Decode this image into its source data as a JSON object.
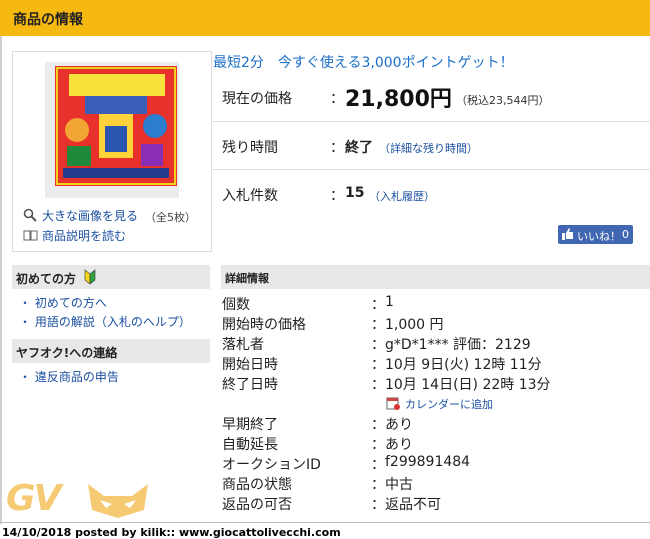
{
  "header": {
    "title": "商品の情報"
  },
  "image": {
    "enlarge_label": "大きな画像を見る",
    "count_label": "（全5枚）",
    "read_desc_label": "商品説明を読む"
  },
  "promo": {
    "text": "最短2分　今すぐ使える3,000ポイントゲット！"
  },
  "price": {
    "label": "現在の価格",
    "value": "21,800円",
    "tax": "（税込23,544円）"
  },
  "remaining": {
    "label": "残り時間",
    "value": "終了",
    "link": "（詳細な残り時間）"
  },
  "bids": {
    "label": "入札件数",
    "value": "15",
    "link": "（入札履歴）"
  },
  "like": {
    "label": "いいね！",
    "count": "0"
  },
  "sidebar": {
    "beginner_title": "初めての方",
    "beginner_items": [
      "初めての方へ",
      "用語の解説（入札のヘルプ）"
    ],
    "contact_title": "ヤフオク!への連絡",
    "contact_items": [
      "違反商品の申告"
    ]
  },
  "details": {
    "title": "詳細情報",
    "rows": [
      {
        "label": "個数",
        "value": "1"
      },
      {
        "label": "開始時の価格",
        "value": "1,000 円"
      },
      {
        "label": "落札者",
        "value": "g*D*1*** 評価：2129"
      },
      {
        "label": "開始日時",
        "value": "10月 9日(火) 12時 11分"
      },
      {
        "label": "終了日時",
        "value": "10月 14日(日) 22時 13分"
      },
      {
        "label": "早期終了",
        "value": "あり"
      },
      {
        "label": "自動延長",
        "value": "あり"
      },
      {
        "label": "オークションID",
        "value": "f299891484"
      },
      {
        "label": "商品の状態",
        "value": "中古"
      },
      {
        "label": "返品の可否",
        "value": "返品不可"
      }
    ],
    "calendar_link": "カレンダーに追加",
    "colon": "："
  },
  "watermark": {
    "text": "GV"
  },
  "footer": {
    "text": "14/10/2018 posted by kilik:: www.giocattolivecchi.com"
  },
  "colors": {
    "header": "#f5b90f",
    "link": "#1a4fa0",
    "promo": "#1a6fc9",
    "facebook": "#4267b2"
  }
}
